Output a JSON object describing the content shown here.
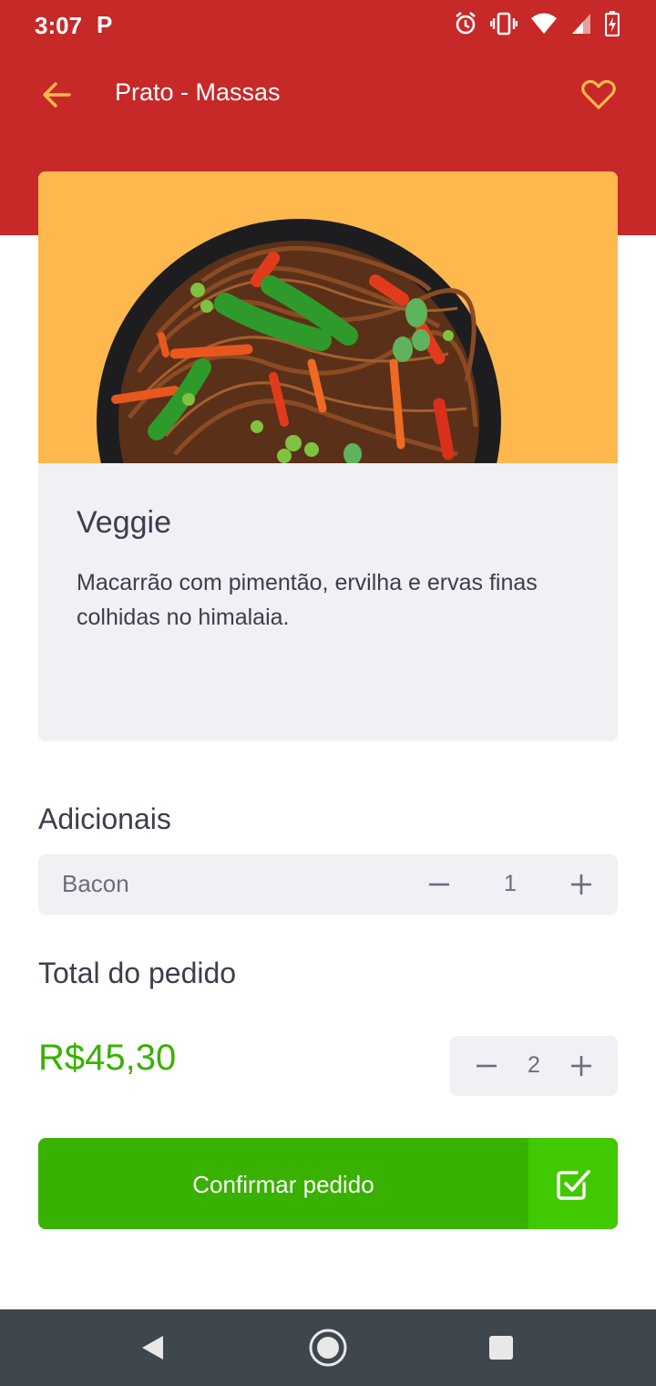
{
  "status_bar": {
    "time": "3:07",
    "notification": "P",
    "icons": [
      "alarm-icon",
      "vibrate-icon",
      "wifi-icon",
      "signal-icon",
      "battery-charging-icon"
    ]
  },
  "header": {
    "title": "Prato - Massas",
    "back_icon": "arrow-left-icon",
    "favorite_icon": "heart-outline-icon"
  },
  "colors": {
    "header_red": "#c72828",
    "accent_yellow": "#ffb84d",
    "card_gray": "#f0f0f5",
    "text_dark": "#3d3d4d",
    "text_muted": "#6c6c80",
    "green": "#39b100",
    "green_light": "#41c900"
  },
  "product": {
    "name": "Veggie",
    "description": "Macarrão com pimentão, ervilha e ervas finas colhidas no himalaia."
  },
  "extras": {
    "title": "Adicionais",
    "items": [
      {
        "name": "Bacon",
        "quantity": "1"
      }
    ]
  },
  "total": {
    "title": "Total do pedido",
    "price": "R$45,30",
    "quantity": "2"
  },
  "confirm": {
    "label": "Confirmar pedido",
    "icon": "check-square-icon"
  },
  "nav": {
    "icons": [
      "back-triangle-icon",
      "home-circle-icon",
      "recents-square-icon"
    ]
  }
}
